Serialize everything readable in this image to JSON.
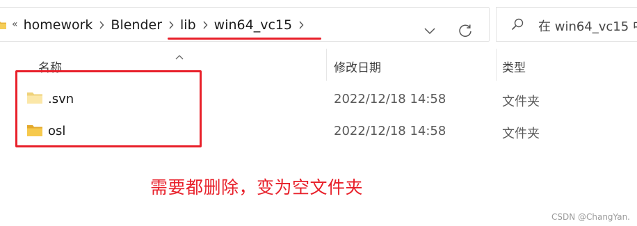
{
  "address_bar": {
    "overflow": "«",
    "breadcrumbs": [
      "homework",
      "Blender",
      "lib",
      "win64_vc15"
    ]
  },
  "search": {
    "placeholder": "在 win64_vc15 中"
  },
  "columns": {
    "name": "名称",
    "date_modified": "修改日期",
    "type": "类型"
  },
  "files": [
    {
      "name": ".svn",
      "date_modified": "2022/12/18 14:58",
      "type": "文件夹",
      "icon": "folder-icon"
    },
    {
      "name": "osl",
      "date_modified": "2022/12/18 14:58",
      "type": "文件夹",
      "icon": "folder-icon"
    }
  ],
  "annotation": {
    "text": "需要都删除，变为空文件夹",
    "color": "#e8202a"
  },
  "watermark": "CSDN @ChangYan."
}
